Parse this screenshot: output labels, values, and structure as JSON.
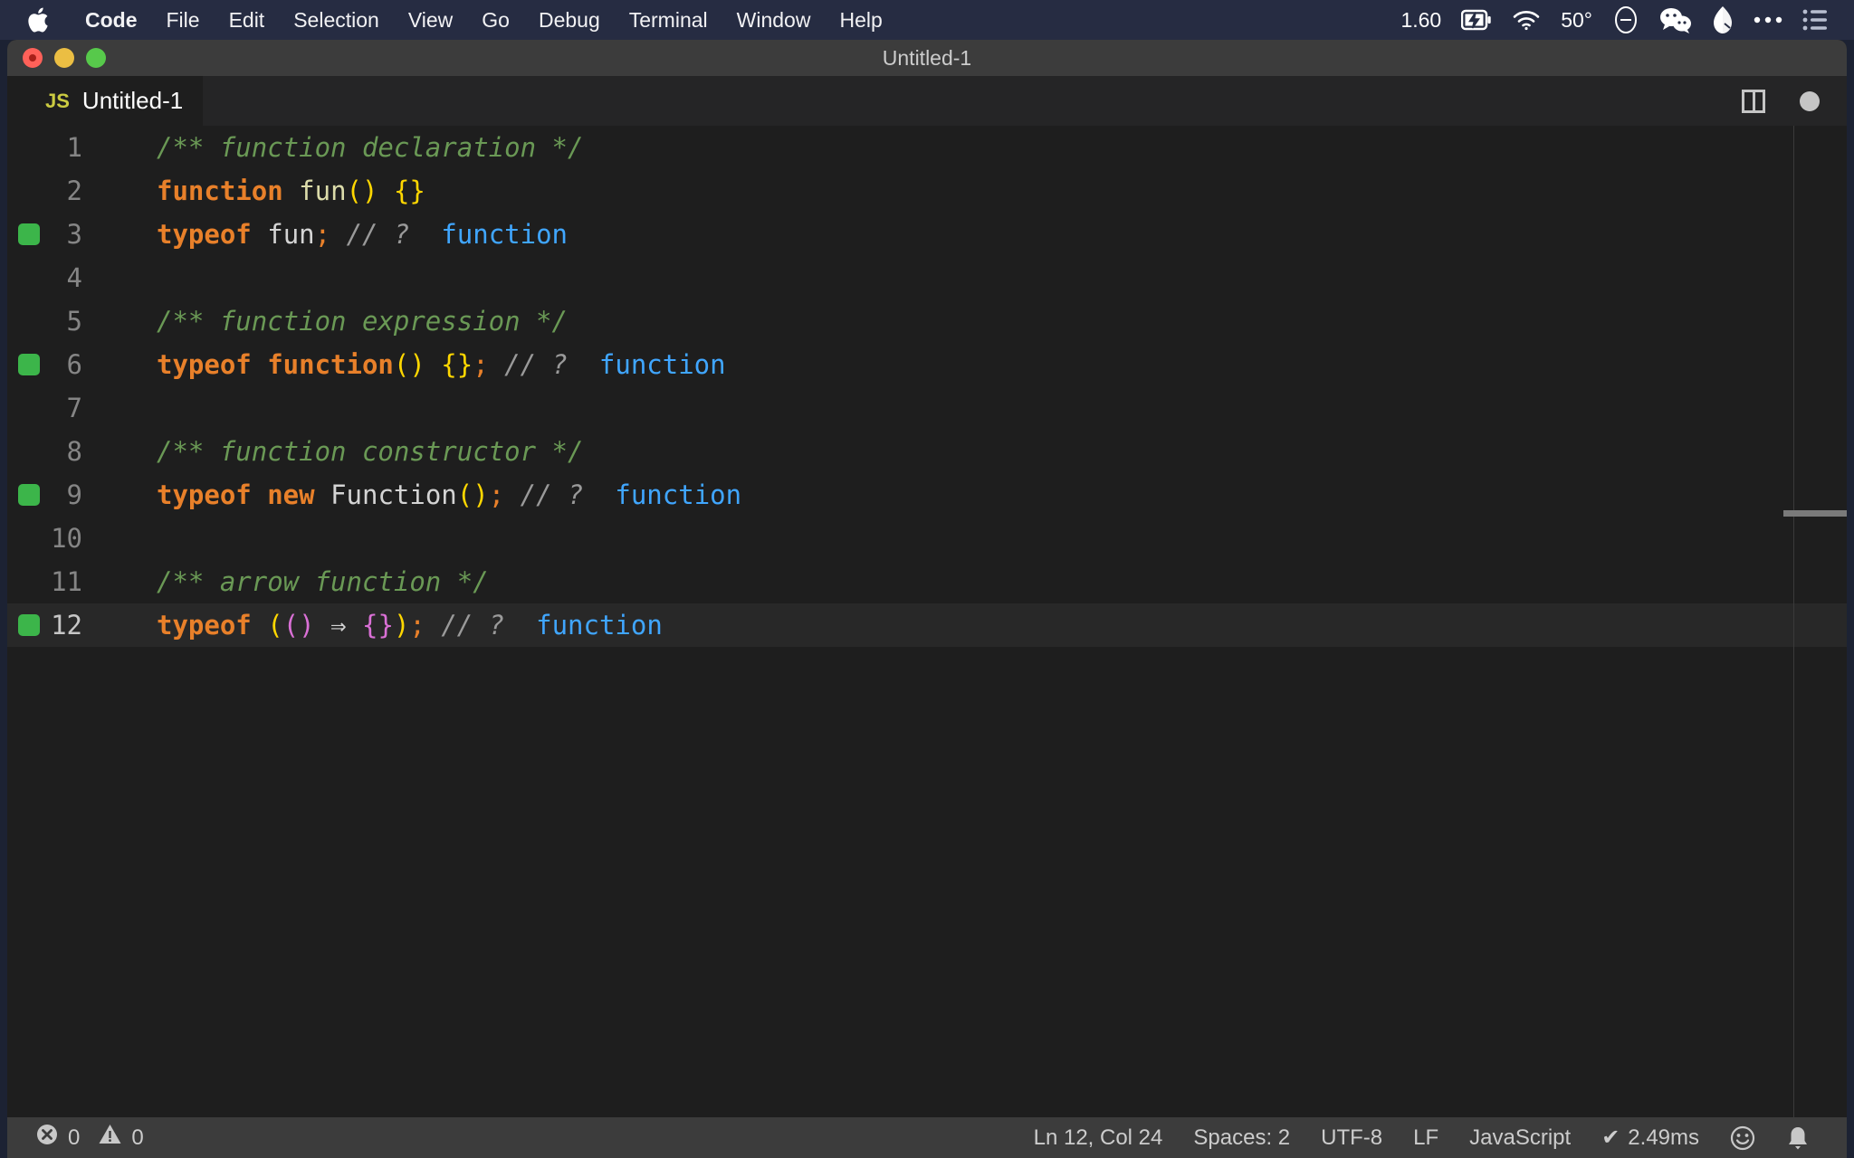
{
  "menubar": {
    "apple_icon": "apple-logo-icon",
    "items": [
      {
        "label": "Code",
        "bold": true
      },
      {
        "label": "File",
        "bold": false
      },
      {
        "label": "Edit",
        "bold": false
      },
      {
        "label": "Selection",
        "bold": false
      },
      {
        "label": "View",
        "bold": false
      },
      {
        "label": "Go",
        "bold": false
      },
      {
        "label": "Debug",
        "bold": false
      },
      {
        "label": "Terminal",
        "bold": false
      },
      {
        "label": "Window",
        "bold": false
      },
      {
        "label": "Help",
        "bold": false
      }
    ],
    "status": {
      "cpu_load": "1.60",
      "battery_icon": "battery-charging-icon",
      "wifi_icon": "wifi-icon",
      "temperature": "50°",
      "dnd_icon": "do-not-disturb-icon",
      "wechat_icon": "wechat-icon",
      "shape_icon": "pin-icon",
      "more_icon": "ellipsis-icon",
      "list_icon": "control-center-icon"
    }
  },
  "window": {
    "title": "Untitled-1",
    "traffic_lights": [
      "close",
      "minimize",
      "zoom"
    ]
  },
  "tab": {
    "badge": "JS",
    "label": "Untitled-1",
    "split_icon": "split-editor-icon",
    "dirty_icon": "unsaved-dot-icon"
  },
  "editor": {
    "lines": [
      {
        "num": "1",
        "marker": false,
        "active": false,
        "tokens": [
          {
            "t": "/** function declaration */",
            "c": "tok-comment"
          }
        ]
      },
      {
        "num": "2",
        "marker": false,
        "active": false,
        "tokens": [
          {
            "t": "function",
            "c": "tok-keyword"
          },
          {
            "t": " ",
            "c": "tok-plain"
          },
          {
            "t": "fun",
            "c": "tok-ident"
          },
          {
            "t": "()",
            "c": "tok-paren-y"
          },
          {
            "t": " ",
            "c": "tok-plain"
          },
          {
            "t": "{}",
            "c": "tok-paren-y"
          }
        ]
      },
      {
        "num": "3",
        "marker": true,
        "active": false,
        "tokens": [
          {
            "t": "typeof",
            "c": "tok-keyword"
          },
          {
            "t": " ",
            "c": "tok-plain"
          },
          {
            "t": "fun",
            "c": "tok-plain"
          },
          {
            "t": ";",
            "c": "tok-punc"
          },
          {
            "t": " ",
            "c": "tok-plain"
          },
          {
            "t": "// ?",
            "c": "tok-slashc"
          },
          {
            "t": "  ",
            "c": "tok-plain"
          },
          {
            "t": "function",
            "c": "tok-value"
          }
        ]
      },
      {
        "num": "4",
        "marker": false,
        "active": false,
        "tokens": []
      },
      {
        "num": "5",
        "marker": false,
        "active": false,
        "tokens": [
          {
            "t": "/** function expression */",
            "c": "tok-comment"
          }
        ]
      },
      {
        "num": "6",
        "marker": true,
        "active": false,
        "tokens": [
          {
            "t": "typeof function",
            "c": "tok-keyword"
          },
          {
            "t": "()",
            "c": "tok-paren-y"
          },
          {
            "t": " ",
            "c": "tok-plain"
          },
          {
            "t": "{}",
            "c": "tok-paren-y"
          },
          {
            "t": ";",
            "c": "tok-punc"
          },
          {
            "t": " ",
            "c": "tok-plain"
          },
          {
            "t": "// ?",
            "c": "tok-slashc"
          },
          {
            "t": "  ",
            "c": "tok-plain"
          },
          {
            "t": "function",
            "c": "tok-value"
          }
        ]
      },
      {
        "num": "7",
        "marker": false,
        "active": false,
        "tokens": []
      },
      {
        "num": "8",
        "marker": false,
        "active": false,
        "tokens": [
          {
            "t": "/** function constructor */",
            "c": "tok-comment"
          }
        ]
      },
      {
        "num": "9",
        "marker": true,
        "active": false,
        "tokens": [
          {
            "t": "typeof new",
            "c": "tok-keyword"
          },
          {
            "t": " ",
            "c": "tok-plain"
          },
          {
            "t": "Function",
            "c": "tok-plain"
          },
          {
            "t": "()",
            "c": "tok-paren-y"
          },
          {
            "t": ";",
            "c": "tok-punc"
          },
          {
            "t": " ",
            "c": "tok-plain"
          },
          {
            "t": "// ?",
            "c": "tok-slashc"
          },
          {
            "t": "  ",
            "c": "tok-plain"
          },
          {
            "t": "function",
            "c": "tok-value"
          }
        ]
      },
      {
        "num": "10",
        "marker": false,
        "active": false,
        "tokens": []
      },
      {
        "num": "11",
        "marker": false,
        "active": false,
        "tokens": [
          {
            "t": "/** arrow function */",
            "c": "tok-comment"
          }
        ]
      },
      {
        "num": "12",
        "marker": true,
        "active": true,
        "tokens": [
          {
            "t": "typeof",
            "c": "tok-keyword"
          },
          {
            "t": " ",
            "c": "tok-plain"
          },
          {
            "t": "(",
            "c": "tok-paren-y"
          },
          {
            "t": "()",
            "c": "tok-paren-p"
          },
          {
            "t": " ⇒ ",
            "c": "tok-plain"
          },
          {
            "t": "{}",
            "c": "tok-paren-p"
          },
          {
            "t": ")",
            "c": "tok-paren-y"
          },
          {
            "t": ";",
            "c": "tok-punc"
          },
          {
            "t": " ",
            "c": "tok-plain"
          },
          {
            "t": "// ?",
            "c": "tok-slashc"
          },
          {
            "t": "  ",
            "c": "tok-plain"
          },
          {
            "t": "function",
            "c": "tok-value"
          }
        ]
      }
    ]
  },
  "statusbar": {
    "errors_icon": "error-circle-icon",
    "errors_count": "0",
    "warnings_icon": "warning-triangle-icon",
    "warnings_count": "0",
    "cursor_position": "Ln 12, Col 24",
    "indentation": "Spaces: 2",
    "encoding": "UTF-8",
    "eol": "LF",
    "language": "JavaScript",
    "quokka_check": "✔",
    "quokka_time": "2.49ms",
    "feedback_icon": "smiley-icon",
    "notifications_icon": "bell-icon"
  },
  "colors": {
    "menubar_bg": "#262c42",
    "titlebar_bg": "#3c3c3c",
    "editor_bg": "#1e1e1e",
    "tabbar_bg": "#252526",
    "statusbar_bg": "#3c3c3c",
    "keyword": "#e8802a",
    "comment": "#6a9955",
    "value": "#40a6ff",
    "bracket_yellow": "#ffd700",
    "bracket_pink": "#da70d6",
    "coverage_green": "#3cb54a",
    "js_badge": "#cbcb41"
  }
}
